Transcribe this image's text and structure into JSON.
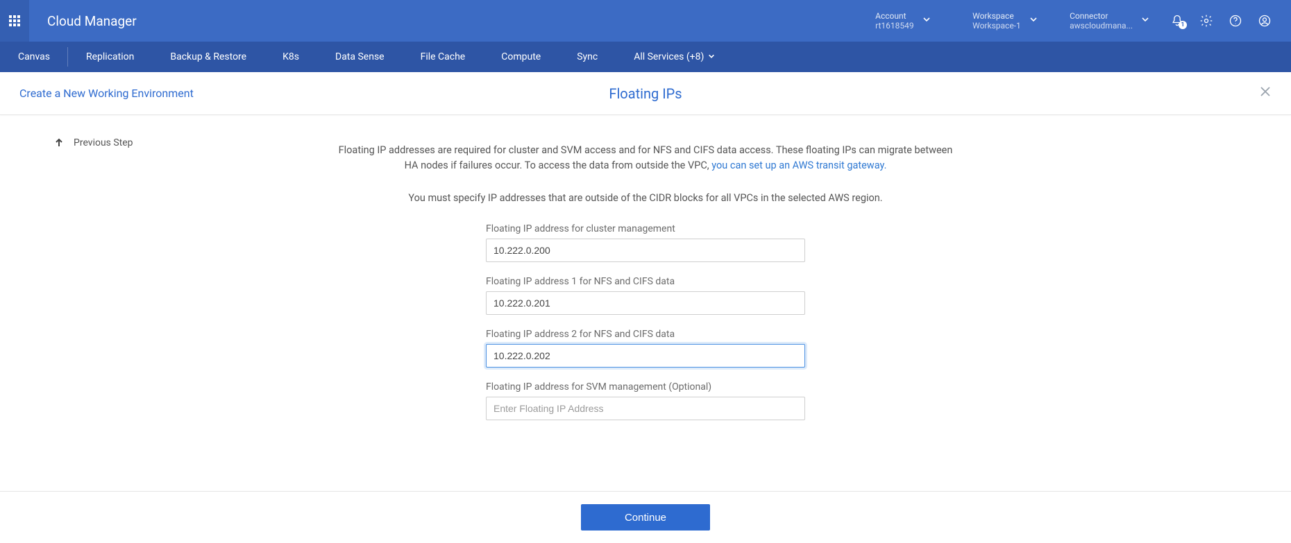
{
  "header": {
    "brand": "Cloud Manager",
    "selectors": {
      "account": {
        "label": "Account",
        "value": "rt1618549"
      },
      "workspace": {
        "label": "Workspace",
        "value": "Workspace-1"
      },
      "connector": {
        "label": "Connector",
        "value": "awscloudmana..."
      }
    },
    "notification_count": "1"
  },
  "nav": {
    "items": [
      "Canvas",
      "Replication",
      "Backup & Restore",
      "K8s",
      "Data Sense",
      "File Cache",
      "Compute",
      "Sync"
    ],
    "all_services": "All Services (+8)"
  },
  "subheader": {
    "left": "Create a New Working Environment",
    "center": "Floating IPs"
  },
  "previous_step": "Previous Step",
  "description": {
    "line1_a": "Floating IP addresses are required for cluster and SVM access and for NFS and CIFS data access. These floating IPs can migrate between HA nodes if failures occur. To access the data from outside the VPC, ",
    "line1_link": "you can set up an AWS transit gateway.",
    "line2": "You must specify IP addresses that are outside of the CIDR blocks for all VPCs in the selected AWS region."
  },
  "form": {
    "fields": [
      {
        "label": "Floating IP address for cluster management",
        "value": "10.222.0.200",
        "placeholder": "",
        "focused": false
      },
      {
        "label": "Floating IP address 1 for NFS and CIFS data",
        "value": "10.222.0.201",
        "placeholder": "",
        "focused": false
      },
      {
        "label": "Floating IP address 2 for NFS and CIFS data",
        "value": "10.222.0.202",
        "placeholder": "",
        "focused": true
      },
      {
        "label": "Floating IP address for SVM management (Optional)",
        "value": "",
        "placeholder": "Enter Floating IP Address",
        "focused": false
      }
    ]
  },
  "footer": {
    "continue": "Continue"
  }
}
